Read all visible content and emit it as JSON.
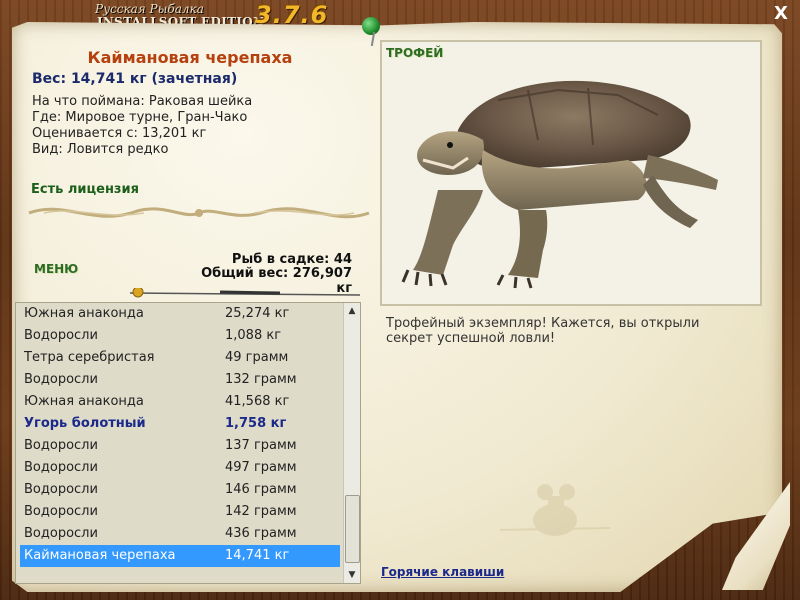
{
  "brand": {
    "top_line": "Русская Рыбалка",
    "edition": "INSTALLSOFT EDITION",
    "version": "3.7.6"
  },
  "window": {
    "close_label": "X"
  },
  "fish": {
    "name": "Каймановая черепаха",
    "weight": "Вес: 14,741 кг (зачетная)",
    "bait": "На что поймана: Раковая шейка",
    "location": "Где: Мировое турне, Гран-Чако",
    "value_from": "Оценивается с: 13,201 кг",
    "kind": "Вид: Ловится редко",
    "license": "Есть лицензия"
  },
  "keepnet": {
    "count": "Рыб в садке: 44",
    "total": "Общий вес: 276,907 кг"
  },
  "menu": {
    "label": "МЕНЮ"
  },
  "catch_list": [
    {
      "name": "Южная анаконда",
      "weight": "25,274 кг"
    },
    {
      "name": "Водоросли",
      "weight": "1,088 кг"
    },
    {
      "name": "Тетра серебристая",
      "weight": "49 грамм"
    },
    {
      "name": "Водоросли",
      "weight": "132 грамм"
    },
    {
      "name": "Южная анаконда",
      "weight": "41,568 кг"
    },
    {
      "name": "Угорь болотный",
      "weight": "1,758 кг"
    },
    {
      "name": "Водоросли",
      "weight": "137 грамм"
    },
    {
      "name": "Водоросли",
      "weight": "497 грамм"
    },
    {
      "name": "Водоросли",
      "weight": "146 грамм"
    },
    {
      "name": "Водоросли",
      "weight": "142 грамм"
    },
    {
      "name": "Водоросли",
      "weight": "436 грамм"
    },
    {
      "name": "Каймановая черепаха",
      "weight": "14,741 кг"
    }
  ],
  "trophy": {
    "label": "ТРОФЕЙ",
    "message": "Трофейный экземпляр! Кажется, вы открыли секрет успешной ловли!"
  },
  "footer": {
    "hotkeys": "Горячие клавиши"
  },
  "colors": {
    "title": "#b5410e",
    "weight": "#1b2a6b",
    "license": "#1c5e1a",
    "selection": "#3399ff",
    "version": "#f2b82a"
  }
}
